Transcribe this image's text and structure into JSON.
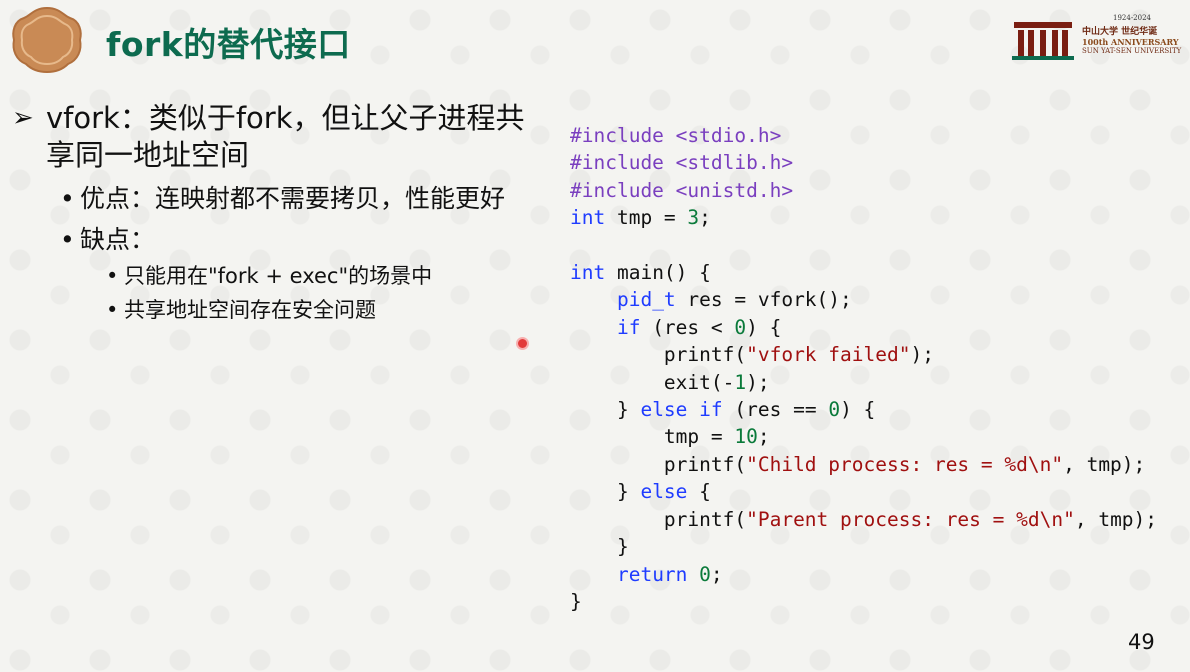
{
  "slide": {
    "title": "fork的替代接口",
    "page_number": "49"
  },
  "university": {
    "years": "1924-2024",
    "name_cn": "中山大学 世纪华诞",
    "anniversary": "100th ANNIVERSARY",
    "name_en": "SUN YAT-SEN UNIVERSITY"
  },
  "bullets": {
    "main": "vfork：类似于fork，但让父子进程共享同一地址空间",
    "pro": "优点：连映射都不需要拷贝，性能更好",
    "con": "缺点：",
    "con_items": [
      "只能用在\"fork + exec\"的场景中",
      "共享地址空间存在安全问题"
    ]
  },
  "code": {
    "language": "c",
    "lines": [
      "#include <stdio.h>",
      "#include <stdlib.h>",
      "#include <unistd.h>",
      "int tmp = 3;",
      "",
      "int main() {",
      "    pid_t res = vfork();",
      "    if (res < 0) {",
      "        printf(\"vfork failed\");",
      "        exit(-1);",
      "    } else if (res == 0) {",
      "        tmp = 10;",
      "        printf(\"Child process: res = %d\\n\", tmp);",
      "    } else {",
      "        printf(\"Parent process: res = %d\\n\", tmp);",
      "    }",
      "    return 0;",
      "}"
    ]
  },
  "colors": {
    "title": "#0d6b4f",
    "badge": "#c98a55",
    "keyword": "#1f3cff",
    "preprocessor": "#7a3fbf"
  }
}
